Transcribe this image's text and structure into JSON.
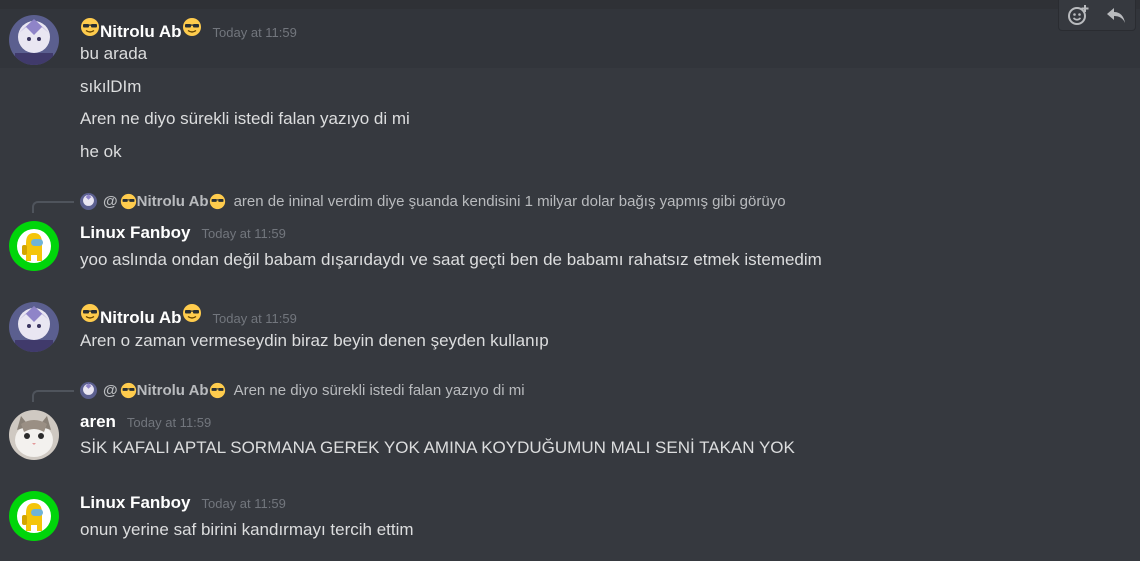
{
  "toolbar": {
    "add_reaction_icon": "add-reaction-icon",
    "reply_icon": "reply-icon"
  },
  "messages": [
    {
      "author": "Nitrolu Ab",
      "timestamp": "Today at 11:59",
      "lines": [
        "bu arada",
        "sıkılDIm",
        "Aren ne diyo sürekli istedi falan yazıyo di mi",
        "he ok"
      ]
    },
    {
      "reply": {
        "mention_prefix": "@",
        "author": "Nitrolu Ab",
        "text": "aren de ininal verdim diye şuanda kendisini 1 milyar dolar bağış yapmış gibi görüyo"
      },
      "author": "Linux Fanboy",
      "timestamp": "Today at 11:59",
      "lines": [
        "yoo aslında ondan değil babam dışarıdaydı ve saat geçti ben de babamı rahatsız etmek istemedim"
      ]
    },
    {
      "author": "Nitrolu Ab",
      "timestamp": "Today at 11:59",
      "lines": [
        "Aren o zaman vermeseydin biraz beyin denen şeyden kullanıp"
      ]
    },
    {
      "reply": {
        "mention_prefix": "@",
        "author": "Nitrolu Ab",
        "text": "Aren ne diyo sürekli istedi falan yazıyo di mi"
      },
      "author": "aren",
      "timestamp": "Today at 11:59",
      "lines": [
        "SİK KAFALI APTAL SORMANA GEREK YOK AMINA KOYDUĞUMUN MALI SENİ TAKAN YOK"
      ]
    },
    {
      "author": "Linux Fanboy",
      "timestamp": "Today at 11:59",
      "lines": [
        "onun yerine saf birini kandırmayı tercih ettim"
      ]
    }
  ],
  "colors": {
    "background": "#36393f",
    "hover_background": "#32353b",
    "text": "#dcddde",
    "muted": "#72767d",
    "username": "#ffffff",
    "green_avatar": "#3ba55d"
  }
}
